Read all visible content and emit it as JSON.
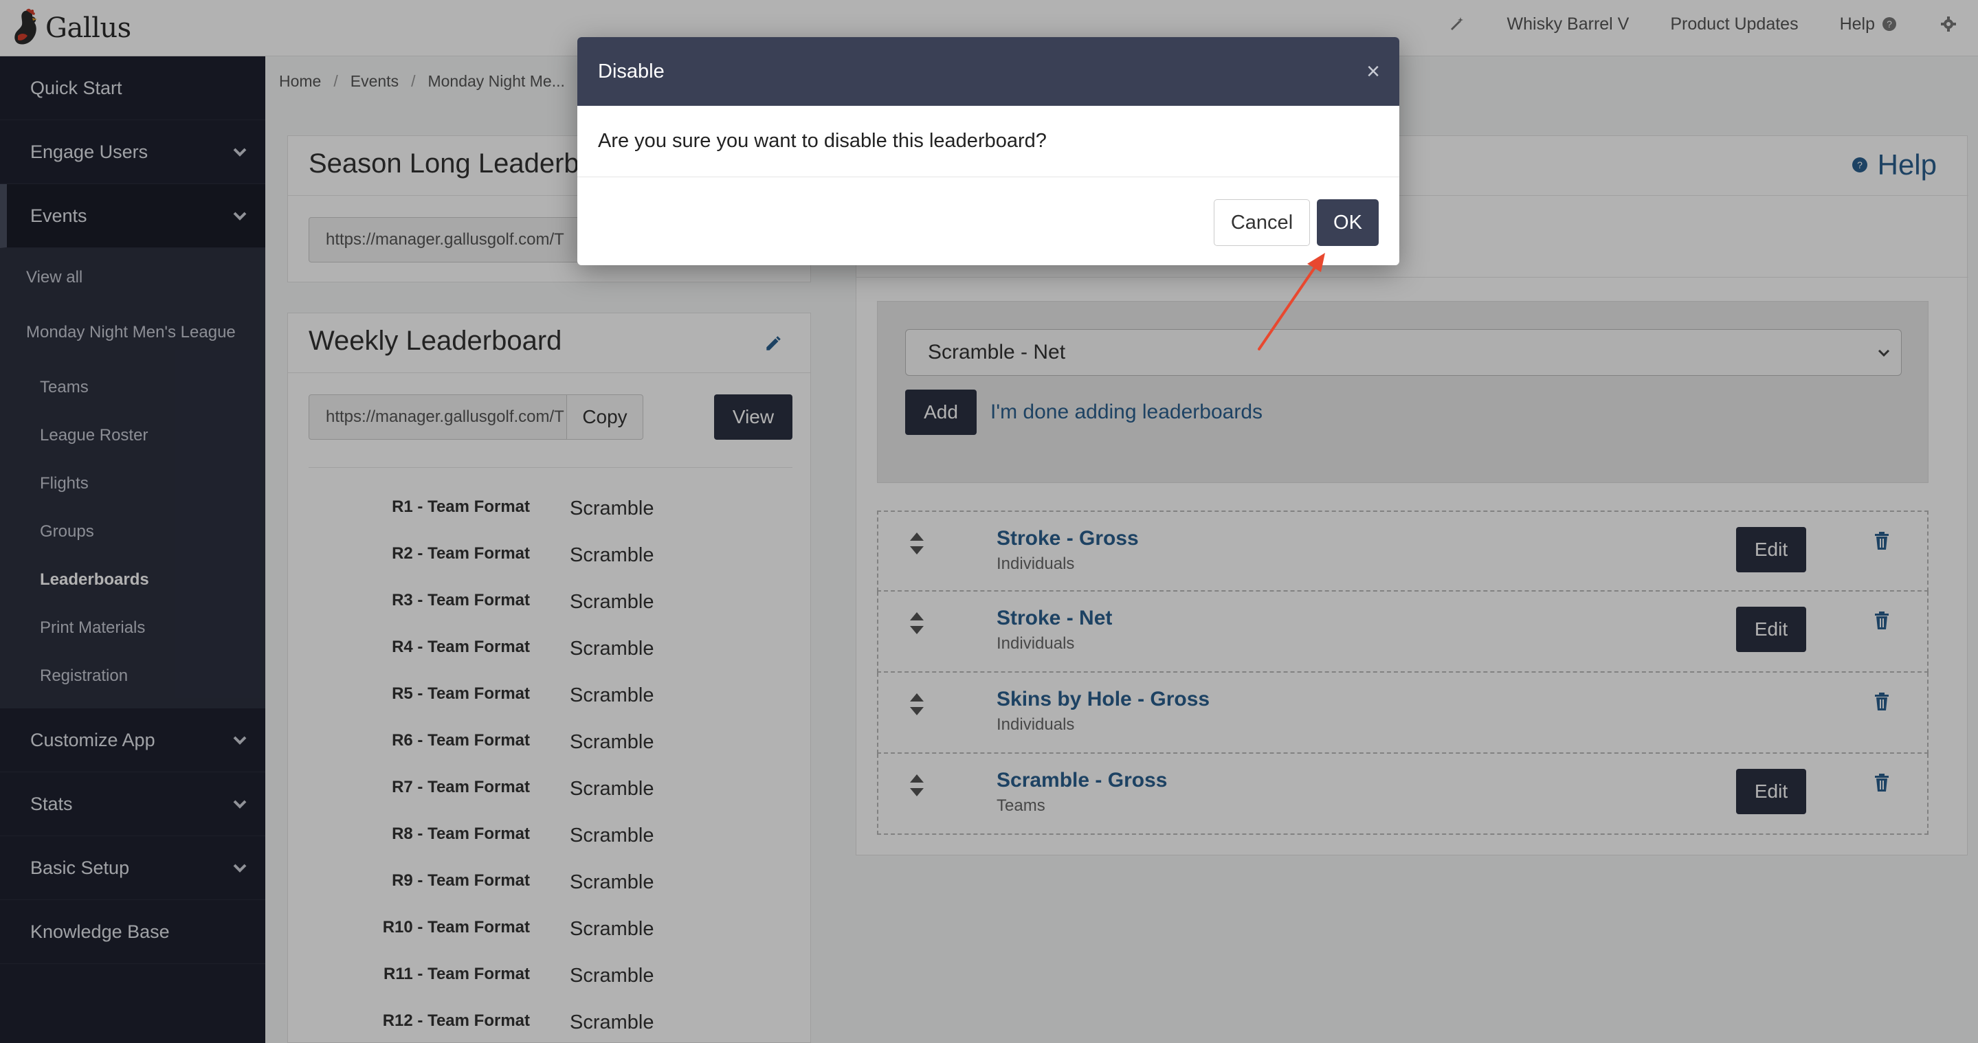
{
  "brand": {
    "name": "Gallus"
  },
  "topnav": {
    "org": "Whisky Barrel V",
    "product_updates": "Product Updates",
    "help": "Help"
  },
  "sidebar": {
    "items": [
      {
        "label": "Quick Start"
      },
      {
        "label": "Engage Users"
      },
      {
        "label": "Events"
      },
      {
        "label": "Customize App"
      },
      {
        "label": "Stats"
      },
      {
        "label": "Basic Setup"
      },
      {
        "label": "Knowledge Base"
      }
    ],
    "events_sub": {
      "view_all": "View all",
      "league": "Monday Night Men's League",
      "children": [
        "Teams",
        "League Roster",
        "Flights",
        "Groups",
        "Leaderboards",
        "Print Materials",
        "Registration"
      ]
    }
  },
  "breadcrumb": [
    "Home",
    "Events",
    "Monday Night Me..."
  ],
  "season_panel": {
    "title": "Season Long Leaderb",
    "url": "https://manager.gallusgolf.com/T"
  },
  "weekly_panel": {
    "title": "Weekly Leaderboard",
    "url": "https://manager.gallusgolf.com/T",
    "copy_label": "Copy",
    "view_label": "View",
    "rows": [
      {
        "label": "R1 - Team Format",
        "value": "Scramble"
      },
      {
        "label": "R2 - Team Format",
        "value": "Scramble"
      },
      {
        "label": "R3 - Team Format",
        "value": "Scramble"
      },
      {
        "label": "R4 - Team Format",
        "value": "Scramble"
      },
      {
        "label": "R5 - Team Format",
        "value": "Scramble"
      },
      {
        "label": "R6 - Team Format",
        "value": "Scramble"
      },
      {
        "label": "R7 - Team Format",
        "value": "Scramble"
      },
      {
        "label": "R8 - Team Format",
        "value": "Scramble"
      },
      {
        "label": "R9 - Team Format",
        "value": "Scramble"
      },
      {
        "label": "R10 - Team Format",
        "value": "Scramble"
      },
      {
        "label": "R11 - Team Format",
        "value": "Scramble"
      },
      {
        "label": "R12 - Team Format",
        "value": "Scramble"
      }
    ]
  },
  "right_panel": {
    "help_label": "Help",
    "select_value": "Scramble - Net",
    "add_label": "Add",
    "done_link": "I'm done adding leaderboards",
    "edit_label": "Edit",
    "leaderboards": [
      {
        "name": "Stroke - Gross",
        "type": "Individuals",
        "editable": true
      },
      {
        "name": "Stroke - Net",
        "type": "Individuals",
        "editable": true
      },
      {
        "name": "Skins by Hole - Gross",
        "type": "Individuals",
        "editable": false
      },
      {
        "name": "Scramble - Gross",
        "type": "Teams",
        "editable": true
      }
    ]
  },
  "modal": {
    "title": "Disable",
    "close": "×",
    "message": "Are you sure you want to disable this leaderboard?",
    "cancel_label": "Cancel",
    "ok_label": "OK"
  },
  "colors": {
    "sidebar_bg": "#1f2230",
    "modal_header": "#3a4055",
    "link": "#2a5f8e",
    "annotation_arrow": "#e8482f"
  }
}
